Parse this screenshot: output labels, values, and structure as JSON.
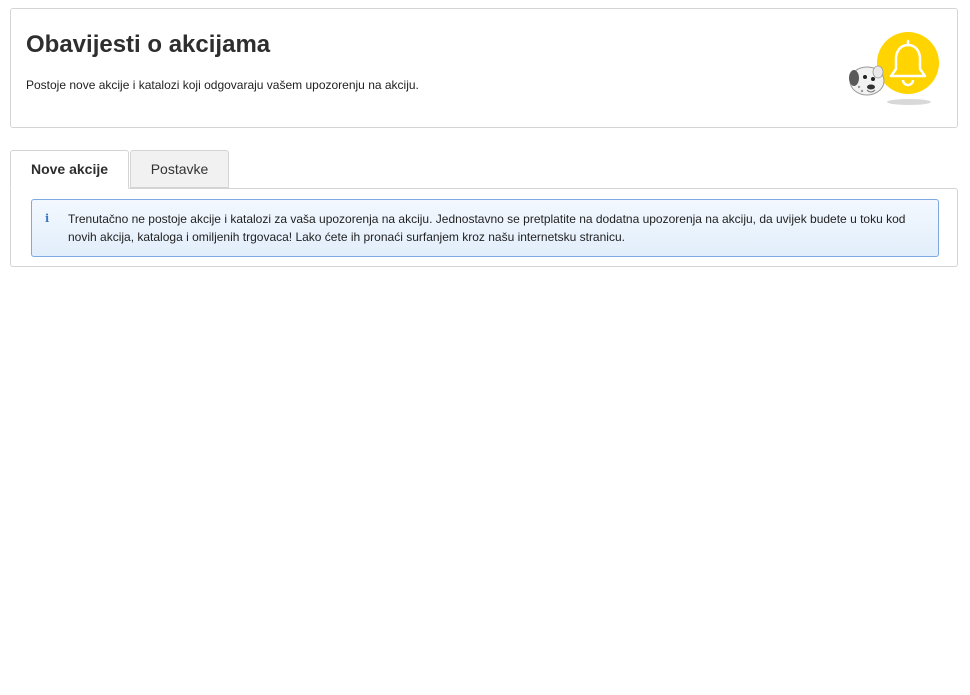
{
  "header": {
    "title": "Obavijesti o akcijama",
    "description": "Postoje nove akcije i katalozi koji odgovaraju vašem upozorenju na akciju.",
    "mascot_icon": "dog-with-bell-icon",
    "accent_color": "#ffd400"
  },
  "tabs": [
    {
      "label": "Nove akcije",
      "active": true
    },
    {
      "label": "Postavke",
      "active": false
    }
  ],
  "info": {
    "icon": "info-icon",
    "icon_glyph": "i",
    "message": "Trenutačno ne postoje akcije i katalozi za vaša upozorenja na akciju. Jednostavno se pretplatite na dodatna upozorenja na akciju, da uvijek budete u toku kod novih akcija, kataloga i omiljenih trgovaca! Lako ćete ih pronaći surfanjem kroz našu internetsku stranicu."
  }
}
